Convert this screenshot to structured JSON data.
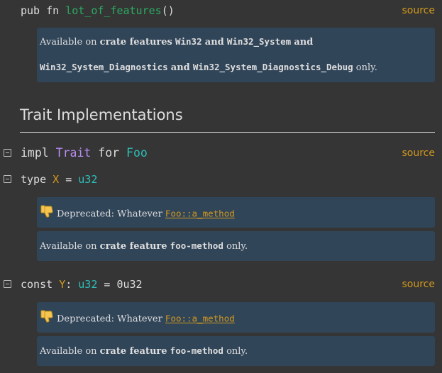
{
  "fn_item": {
    "keyword": "pub fn ",
    "name": "lot_of_features",
    "parens": "()",
    "source_label": "source",
    "stab": {
      "prefix": "Available on ",
      "crate_features_label": "crate features",
      "feature_1": "Win32",
      "and_1": "and",
      "feature_2": "Win32_System",
      "and_2": "and",
      "feature_3": "Win32_System_Diagnostics",
      "and_3": "and",
      "feature_4": "Win32_System_Diagnostics_Debug",
      "suffix": "only."
    }
  },
  "trait_impls": {
    "heading": "Trait Implementations",
    "impl": {
      "keyword_impl": "impl ",
      "trait_name": "Trait",
      "keyword_for": " for ",
      "type_name": "Foo",
      "source_label": "source"
    },
    "assoc_type": {
      "keyword": "type ",
      "name": "X",
      "eq": " = ",
      "value": "u32",
      "deprecated": {
        "label": "Deprecated: Whatever ",
        "link": "Foo::a_method"
      },
      "stab": {
        "prefix": "Available on ",
        "crate_feature_label": "crate feature",
        "feature": "foo-method",
        "suffix": "only."
      }
    },
    "assoc_const": {
      "keyword": "const ",
      "name": "Y",
      "colon": ": ",
      "type": "u32",
      "eq_value": " = 0u32",
      "source_label": "source",
      "deprecated": {
        "label": "Deprecated: Whatever ",
        "link": "Foo::a_method"
      },
      "stab": {
        "prefix": "Available on ",
        "crate_feature_label": "crate feature",
        "feature": "foo-method",
        "suffix": "only."
      }
    }
  },
  "colors": {
    "background": "#353535",
    "text": "#dddddd",
    "function": "#2bab63",
    "trait": "#b78cf2",
    "struct": "#2dbfb8",
    "assoc": "#d2991d",
    "source_link": "#d2991d",
    "stab_bg": "#314559",
    "thumb_icon": "#f5c451"
  },
  "icons": {
    "toggle": "collapse-toggle-icon",
    "deprecated": "thumbs-down-icon"
  }
}
